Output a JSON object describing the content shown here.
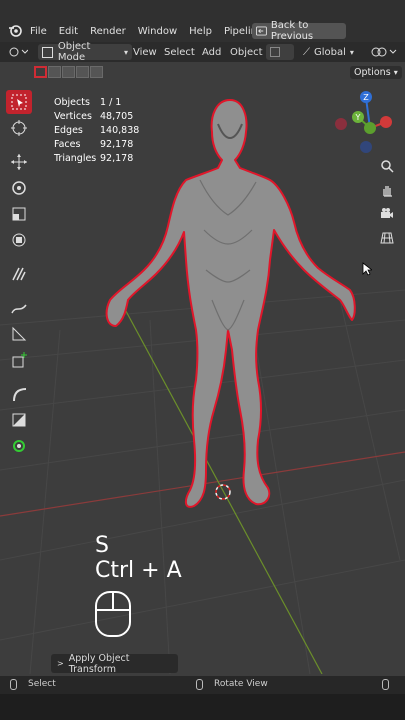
{
  "menu": [
    "File",
    "Edit",
    "Render",
    "Window",
    "Help",
    "Pipeline"
  ],
  "back_button": "Back to Previous",
  "header": {
    "mode": "Object Mode",
    "view": "View",
    "select": "Select",
    "add": "Add",
    "object": "Object",
    "orientation": "Global"
  },
  "options_label": "Options",
  "stats": [
    {
      "k": "Objects",
      "v": "1 / 1"
    },
    {
      "k": "Vertices",
      "v": "48,705"
    },
    {
      "k": "Edges",
      "v": "140,838"
    },
    {
      "k": "Faces",
      "v": "92,178"
    },
    {
      "k": "Triangles",
      "v": "92,178"
    }
  ],
  "gizmo": {
    "z": "Z",
    "y": "Y"
  },
  "shortcut": {
    "line1": "S",
    "line2": "Ctrl + A"
  },
  "last_operation": "Apply Object Transform",
  "status": {
    "select": "Select",
    "rotate": "Rotate View"
  }
}
